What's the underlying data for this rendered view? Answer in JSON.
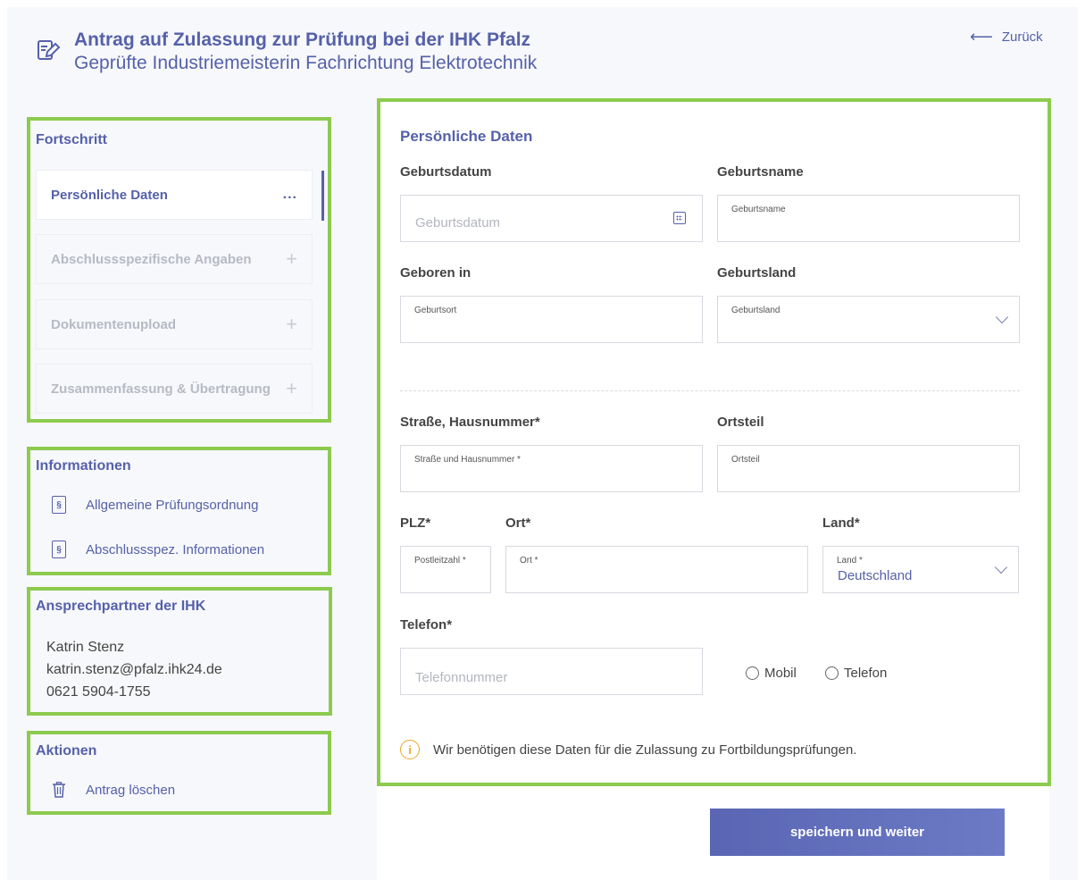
{
  "header": {
    "title": "Antrag auf Zulassung zur Prüfung bei der IHK Pfalz",
    "subtitle": "Geprüfte Industriemeisterin Fachrichtung Elektrotechnik",
    "back_arrow": "⟵",
    "back_label": "Zurück",
    "icon": "edit-document-icon"
  },
  "progress": {
    "heading": "Fortschritt",
    "steps": [
      {
        "label": "Persönliche Daten",
        "marker": "...",
        "state": "active"
      },
      {
        "label": "Abschlussspezifische Angaben",
        "marker": "+",
        "state": "inactive"
      },
      {
        "label": "Dokumentenupload",
        "marker": "+",
        "state": "inactive"
      },
      {
        "label": "Zusammenfassung & Übertragung",
        "marker": "+",
        "state": "inactive"
      }
    ]
  },
  "information": {
    "heading": "Informationen",
    "links": [
      {
        "label": "Allgemeine Prüfungsordnung",
        "icon_text": "§"
      },
      {
        "label": "Abschlussspez. Informationen",
        "icon_text": "§"
      }
    ]
  },
  "contact": {
    "heading": "Ansprechpartner der IHK",
    "name": "Katrin Stenz",
    "email": "katrin.stenz@pfalz.ihk24.de",
    "phone": "0621 5904-1755"
  },
  "actions": {
    "heading": "Aktionen",
    "delete_label": "Antrag löschen"
  },
  "form": {
    "section_title": "Persönliche Daten",
    "birthdate": {
      "label": "Geburtsdatum",
      "placeholder": "Geburtsdatum"
    },
    "birthname": {
      "label": "Geburtsname",
      "placeholder": "Geburtsname"
    },
    "birthplace": {
      "label": "Geboren in",
      "placeholder": "Geburtsort"
    },
    "birthcountry": {
      "label": "Geburtsland",
      "placeholder": "Geburtsland"
    },
    "street": {
      "label": "Straße, Hausnummer*",
      "placeholder": "Straße und Hausnummer *"
    },
    "district": {
      "label": "Ortsteil",
      "placeholder": "Ortsteil"
    },
    "zip": {
      "label": "PLZ*",
      "placeholder": "Postleitzahl *"
    },
    "city": {
      "label": "Ort*",
      "placeholder": "Ort *"
    },
    "country": {
      "label": "Land*",
      "placeholder": "Land *",
      "value": "Deutschland"
    },
    "phone": {
      "label": "Telefon*",
      "placeholder": "Telefonnummer",
      "options": [
        "Mobil",
        "Telefon"
      ]
    },
    "note": "Wir benötigen diese Daten für die Zulassung zu Fortbildungsprüfungen.",
    "note_icon": "i",
    "submit_label": "speichern und weiter"
  },
  "colors": {
    "accent": "#5561a9",
    "highlight": "#8ccb4e",
    "info": "#e8a92b"
  }
}
